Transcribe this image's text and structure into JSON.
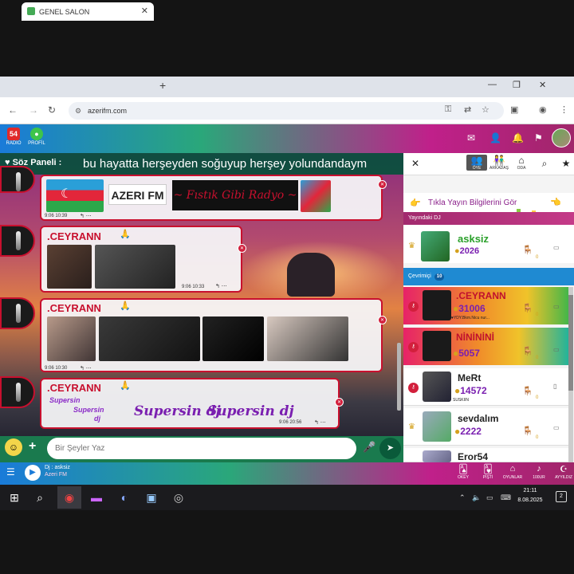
{
  "browser": {
    "tab_title": "GENEL SALON",
    "url": "azerifm.com"
  },
  "site_header": {
    "radio_label": "RADIO",
    "profile_label": "PROFİL"
  },
  "chat": {
    "panel_label": "Söz Paneli :",
    "marquee": "bu hayatta herşeyden soğuyup herşey yolundandaym",
    "input_placeholder": "Bir Şeyler Yaz",
    "messages": [
      {
        "time": "9:06 10:39",
        "logo1": "AZERI FM",
        "logo2": "~ Fıstık Gibi Radyo ~"
      },
      {
        "name": ".CEYRANN",
        "time": "9:06 10:33"
      },
      {
        "name": ".CEYRANN",
        "time": "9:06 10:30"
      },
      {
        "name": ".CEYRANN",
        "time": "9:06 20:56",
        "text1": "Supersin dj",
        "text2": "Supersin dj",
        "glitter1": "Supersin",
        "glitter2": "Supersin",
        "glitter3": "dj"
      }
    ]
  },
  "right_panel": {
    "tabs": [
      {
        "icon": "users-icon",
        "label": "ÖYE"
      },
      {
        "icon": "friends-icon",
        "label": "ARKADAŞ"
      },
      {
        "icon": "home-icon",
        "label": "ODA"
      }
    ],
    "banner_text": "Tıkla Yayın Bilgilerini Gör",
    "dj_header": "Yayındaki DJ",
    "dj": {
      "name": "asksiz",
      "points": "2026",
      "zero": "0"
    },
    "online_header": "Çevrimiçi",
    "online_count": "10",
    "users": [
      {
        "name": ".CEYRANN",
        "points": "31006",
        "status": "♥YDY.Bkm.Nicu nur...",
        "zero": "0"
      },
      {
        "name": "NİNİNİNİ",
        "points": "5057",
        "status": "",
        "zero": "0"
      },
      {
        "name": "MeRt",
        "points": "14572",
        "status": "SUSKIIN",
        "zero": "0"
      },
      {
        "name": "sevdalım",
        "points": "2222",
        "status": "",
        "zero": "0"
      },
      {
        "name": "Eror54",
        "points": "",
        "status": "",
        "zero": ""
      }
    ]
  },
  "footer": {
    "dj_line1": "Dj : asksiz",
    "dj_line2": "Azeri FM",
    "buttons": [
      "OKEY",
      "PİŞTİ",
      "OYUNLAR",
      "100UR",
      "AYYILDIZ"
    ]
  },
  "taskbar": {
    "time": "21:11",
    "date": "8.08.2025",
    "notification_count": "2"
  },
  "colors": {
    "accent_red": "#c8102e",
    "green_bar": "#1a7a4e",
    "blue": "#1f8ad2",
    "magenta": "#a22a6e"
  }
}
